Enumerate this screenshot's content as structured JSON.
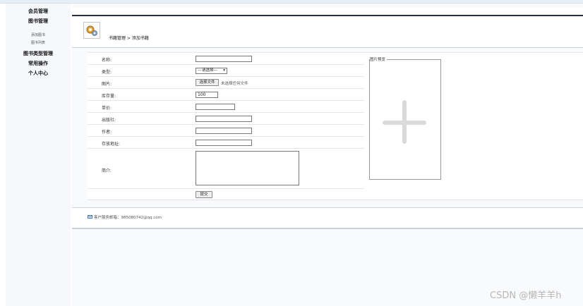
{
  "sidebar": {
    "items": [
      {
        "label": "会员管理",
        "type": "head"
      },
      {
        "label": "图书管理",
        "type": "head"
      },
      {
        "label": "添加图书",
        "type": "sub"
      },
      {
        "label": "图书列表",
        "type": "sub"
      },
      {
        "label": "图书类型管理",
        "type": "head"
      },
      {
        "label": "常用操作",
        "type": "head"
      },
      {
        "label": "个人中心",
        "type": "head"
      }
    ]
  },
  "breadcrumb": "书籍管理 > 添加书籍",
  "form": {
    "name_label": "名称:",
    "category_label": "类型:",
    "category_selected": "---请选择---",
    "image_label": "图片:",
    "choose_file_button": "选择文件",
    "no_file_text": "未选择任何文件",
    "stock_label": "库存量:",
    "stock_value": "100",
    "price_label": "单价:",
    "publisher_label": "出版社:",
    "author_label": "作者:",
    "location_label": "存放地址:",
    "intro_label": "简介:",
    "submit_button": "提交"
  },
  "preview": {
    "legend": "图片预览"
  },
  "footer": {
    "text": "客户服务邮箱：985080742@qq.com"
  },
  "watermark": "CSDN @懒羊羊h"
}
